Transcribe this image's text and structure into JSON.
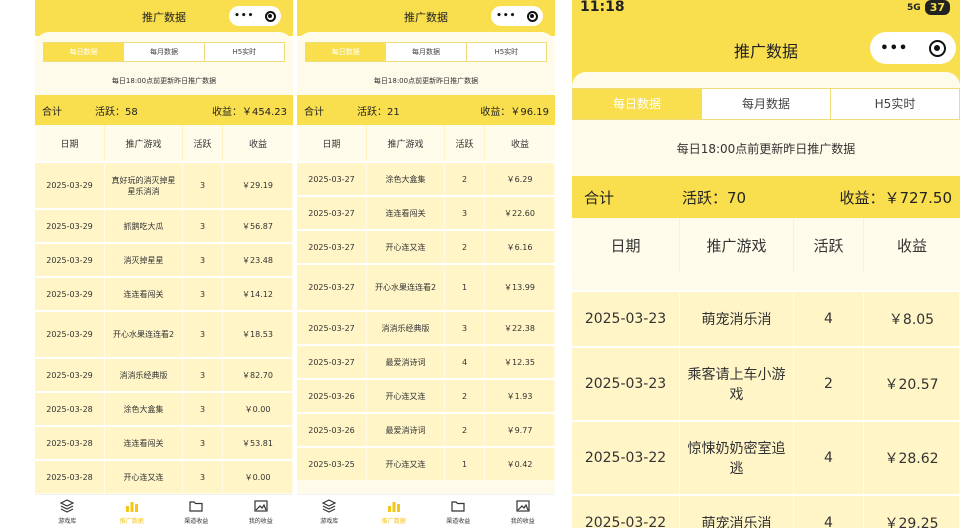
{
  "status_bar": {
    "time": "11:18",
    "signal": "5G",
    "battery": "37"
  },
  "nav_title": "推广数据",
  "capsule": {
    "dots": "•••"
  },
  "tabs": [
    {
      "label": "每日数据",
      "active": true
    },
    {
      "label": "每月数据",
      "active": false
    },
    {
      "label": "H5实时",
      "active": false
    }
  ],
  "note": "每日18:00点前更新昨日推广数据",
  "columns": [
    "日期",
    "推广游戏",
    "活跃",
    "收益"
  ],
  "bottom_nav": [
    {
      "label": "游戏库",
      "icon": "layers-icon",
      "active": false
    },
    {
      "label": "推广数据",
      "icon": "bar-chart-icon",
      "active": true
    },
    {
      "label": "渠道收益",
      "icon": "folder-icon",
      "active": false
    },
    {
      "label": "我的收益",
      "icon": "image-icon",
      "active": false
    }
  ],
  "screens": [
    {
      "summary": {
        "total": "合计",
        "active": "活跃：58",
        "income": "收益：￥454.23"
      },
      "rows": [
        {
          "date": "2025-03-29",
          "game": "真好玩的消灭掉星星乐消消",
          "active": "3",
          "income": "￥29.19"
        },
        {
          "date": "2025-03-29",
          "game": "抓鹅吃大瓜",
          "active": "3",
          "income": "￥56.87"
        },
        {
          "date": "2025-03-29",
          "game": "消灭掉星星",
          "active": "3",
          "income": "￥23.48"
        },
        {
          "date": "2025-03-29",
          "game": "连连看闯关",
          "active": "3",
          "income": "￥14.12"
        },
        {
          "date": "2025-03-29",
          "game": "开心水果连连看2",
          "active": "3",
          "income": "￥18.53"
        },
        {
          "date": "2025-03-29",
          "game": "消消乐经典版",
          "active": "3",
          "income": "￥82.70"
        },
        {
          "date": "2025-03-28",
          "game": "涂色大盒集",
          "active": "3",
          "income": "￥0.00"
        },
        {
          "date": "2025-03-28",
          "game": "连连看闯关",
          "active": "3",
          "income": "￥53.81"
        },
        {
          "date": "2025-03-28",
          "game": "开心连又连",
          "active": "3",
          "income": "￥0.00"
        }
      ]
    },
    {
      "summary": {
        "total": "合计",
        "active": "活跃：21",
        "income": "收益：￥96.19"
      },
      "rows": [
        {
          "date": "2025-03-27",
          "game": "涂色大盒集",
          "active": "2",
          "income": "￥6.29"
        },
        {
          "date": "2025-03-27",
          "game": "连连看闯关",
          "active": "3",
          "income": "￥22.60"
        },
        {
          "date": "2025-03-27",
          "game": "开心连又连",
          "active": "2",
          "income": "￥6.16"
        },
        {
          "date": "2025-03-27",
          "game": "开心水果连连看2",
          "active": "1",
          "income": "￥13.99"
        },
        {
          "date": "2025-03-27",
          "game": "消消乐经典版",
          "active": "3",
          "income": "￥22.38"
        },
        {
          "date": "2025-03-27",
          "game": "最爱消诗词",
          "active": "4",
          "income": "￥12.35"
        },
        {
          "date": "2025-03-26",
          "game": "开心连又连",
          "active": "2",
          "income": "￥1.93"
        },
        {
          "date": "2025-03-26",
          "game": "最爱消诗词",
          "active": "2",
          "income": "￥9.77"
        },
        {
          "date": "2025-03-25",
          "game": "开心连又连",
          "active": "1",
          "income": "￥0.42"
        }
      ]
    },
    {
      "summary": {
        "total": "合计",
        "active": "活跃：70",
        "income": "收益：￥727.50"
      },
      "rows": [
        {
          "date": "2025-03-23",
          "game": "萌宠消乐消",
          "active": "4",
          "income": "￥8.05"
        },
        {
          "date": "2025-03-23",
          "game": "乘客请上车小游戏",
          "active": "2",
          "income": "￥20.57"
        },
        {
          "date": "2025-03-22",
          "game": "惊悚奶奶密室追逃",
          "active": "4",
          "income": "￥28.62"
        },
        {
          "date": "2025-03-22",
          "game": "萌宠消乐消",
          "active": "4",
          "income": "￥29.25"
        }
      ]
    }
  ]
}
